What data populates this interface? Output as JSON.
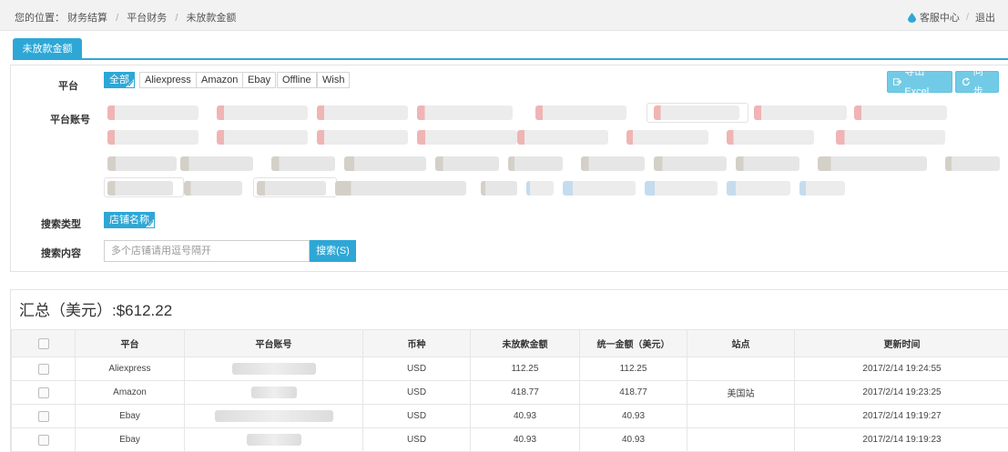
{
  "breadcrumb": {
    "prefix": "您的位置：",
    "items": [
      "财务结算",
      "平台财务",
      "未放款金额"
    ]
  },
  "top_links": {
    "service": "客服中心",
    "logout": "退出"
  },
  "tab": {
    "label": "未放款金额"
  },
  "filters": {
    "platform_label": "平台",
    "platforms": [
      "全部",
      "Aliexpress",
      "Amazon",
      "Ebay",
      "Offline",
      "Wish"
    ],
    "account_label": "平台账号",
    "search_type_label": "搜索类型",
    "search_type_value": "店铺名称",
    "search_content_label": "搜索内容",
    "search_placeholder": "多个店铺请用逗号隔开",
    "search_button": "搜索(S)",
    "export_button": "导出Excel",
    "sync_button": "同步"
  },
  "summary": {
    "text": "汇总（美元）:$612.22"
  },
  "table": {
    "headers": [
      "平台",
      "平台账号",
      "币种",
      "未放款金额",
      "统一金额（美元）",
      "站点",
      "更新时间"
    ],
    "rows": [
      {
        "platform": "Aliexpress",
        "currency": "USD",
        "amount": "112.25",
        "usd": "112.25",
        "site": "",
        "updated": "2017/2/14 19:24:55"
      },
      {
        "platform": "Amazon",
        "currency": "USD",
        "amount": "418.77",
        "usd": "418.77",
        "site": "美国站",
        "updated": "2017/2/14 19:23:25"
      },
      {
        "platform": "Ebay",
        "currency": "USD",
        "amount": "40.93",
        "usd": "40.93",
        "site": "",
        "updated": "2017/2/14 19:19:27"
      },
      {
        "platform": "Ebay",
        "currency": "USD",
        "amount": "40.93",
        "usd": "40.93",
        "site": "",
        "updated": "2017/2/14 19:19:23"
      }
    ]
  },
  "colors": {
    "accent": "#2ea7d6",
    "accent_light": "#72cbe6"
  },
  "icons": {
    "service": "water-drop-icon",
    "export": "export-icon",
    "sync": "refresh-icon",
    "check": "checkmark-icon"
  }
}
